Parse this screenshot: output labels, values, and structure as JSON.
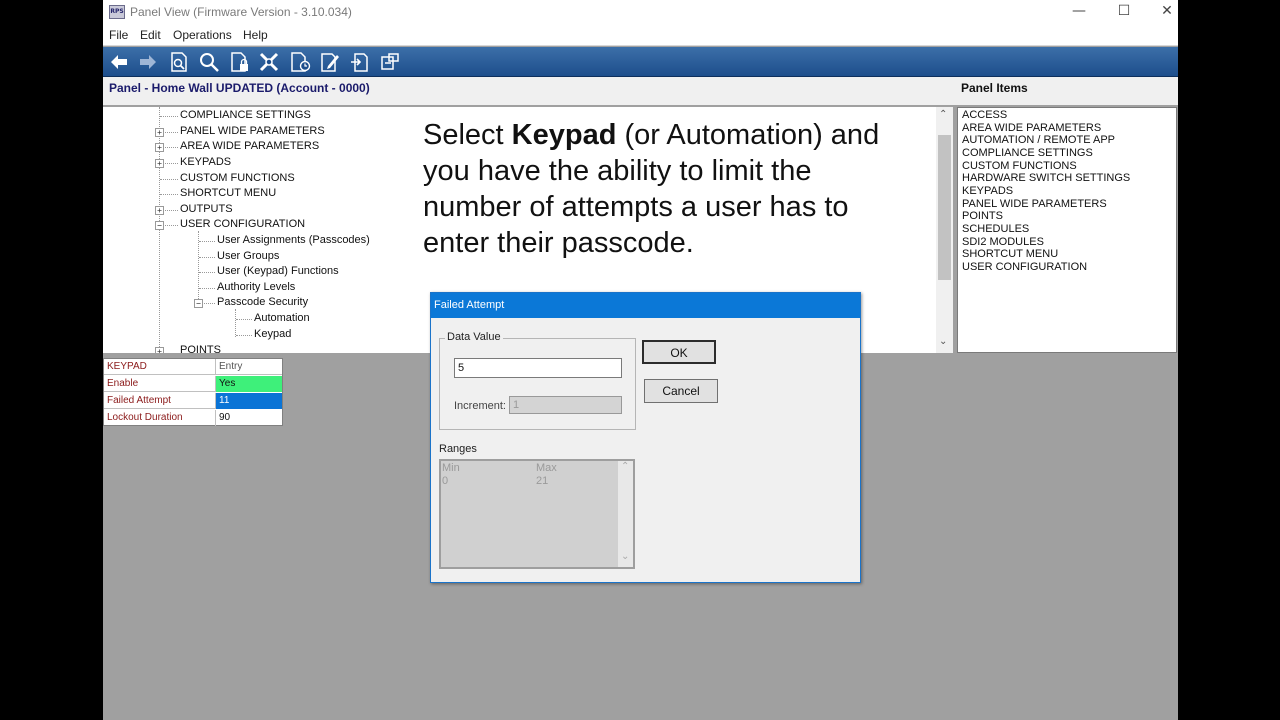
{
  "window": {
    "title": "Panel View (Firmware Version - 3.10.034)",
    "logo_text": "RPS",
    "controls": [
      "—",
      "☐",
      "✕"
    ]
  },
  "menu": [
    "File",
    "Edit",
    "Operations",
    "Help"
  ],
  "toolbar": {
    "icons": [
      "back-arrow-icon",
      "forward-arrow-icon",
      "find-document-icon",
      "search-icon",
      "lock-document-icon",
      "tools-icon",
      "clock-document-icon",
      "edit-document-icon",
      "export-document-icon",
      "send-panel-icon"
    ]
  },
  "header": {
    "panel_title": "Panel - Home Wall UPDATED (Account - 0000)",
    "panel_items_title": "Panel Items"
  },
  "tree": {
    "nodes": [
      {
        "label": "COMPLIANCE SETTINGS",
        "expander": ""
      },
      {
        "label": "PANEL WIDE PARAMETERS",
        "expander": "+"
      },
      {
        "label": "AREA WIDE PARAMETERS",
        "expander": "+"
      },
      {
        "label": "KEYPADS",
        "expander": "+"
      },
      {
        "label": "CUSTOM FUNCTIONS",
        "expander": ""
      },
      {
        "label": "SHORTCUT MENU",
        "expander": ""
      },
      {
        "label": "OUTPUTS",
        "expander": "+"
      },
      {
        "label": "USER CONFIGURATION",
        "expander": "−"
      },
      {
        "label": "User Assignments (Passcodes)",
        "expander": ""
      },
      {
        "label": "User Groups",
        "expander": ""
      },
      {
        "label": "User (Keypad) Functions",
        "expander": ""
      },
      {
        "label": "Authority Levels",
        "expander": ""
      },
      {
        "label": "Passcode Security",
        "expander": "−"
      },
      {
        "label": "Automation",
        "expander": ""
      },
      {
        "label": "Keypad",
        "expander": ""
      },
      {
        "label": "POINTS",
        "expander": "+"
      }
    ]
  },
  "annotation": {
    "select": "Select ",
    "bold": "Keypad",
    "rest": " (or Automation) and you have the ability to limit the number of attempts a user has to enter their passcode."
  },
  "panel_items": [
    "ACCESS",
    "AREA WIDE PARAMETERS",
    "AUTOMATION / REMOTE APP",
    "COMPLIANCE SETTINGS",
    "CUSTOM FUNCTIONS",
    "HARDWARE SWITCH SETTINGS",
    "KEYPADS",
    "PANEL WIDE PARAMETERS",
    "POINTS",
    "SCHEDULES",
    "SDI2 MODULES",
    "SHORTCUT MENU",
    "USER CONFIGURATION"
  ],
  "props": {
    "header": {
      "key": "KEYPAD",
      "value": "Entry"
    },
    "rows": [
      {
        "key": "Enable",
        "value": "Yes",
        "value_bg": "#3ef07a"
      },
      {
        "key": "Failed Attempt",
        "value": "11",
        "value_bg": "#0a74d6"
      },
      {
        "key": "Lockout Duration",
        "value": "90",
        "value_bg": "#ffffff"
      }
    ]
  },
  "dialog": {
    "title": "Failed Attempt",
    "data_value_label": "Data Value",
    "data_value": "5",
    "increment_label": "Increment:",
    "increment_value": "1",
    "ok_label": "OK",
    "cancel_label": "Cancel",
    "ranges_label": "Ranges",
    "ranges": {
      "min_label": "Min",
      "max_label": "Max",
      "min": "0",
      "max": "21"
    }
  },
  "colors": {
    "accent": "#0b78d7",
    "toolbar": "#1d4e8c"
  }
}
